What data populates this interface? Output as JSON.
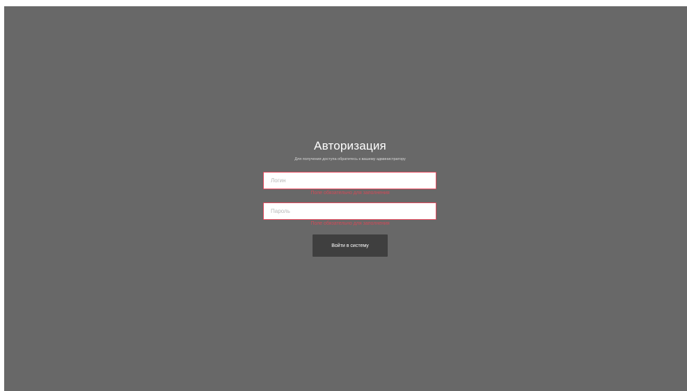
{
  "auth": {
    "title": "Авторизация",
    "subtitle": "Для получения доступа обратитесь к вашему администратору",
    "login": {
      "placeholder": "Логин",
      "value": "",
      "error": "Поле обязательно для заполнения"
    },
    "password": {
      "placeholder": "Пароль",
      "value": "",
      "error": "Поле обязательно для заполнения"
    },
    "submit_label": "Войти в систему"
  },
  "colors": {
    "overlay_background": "#686868",
    "error_border": "#e64b5f",
    "button_background": "#3f3f3f"
  }
}
